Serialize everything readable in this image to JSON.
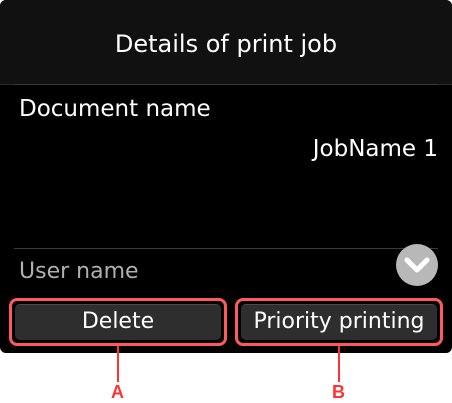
{
  "screen": {
    "title": "Details of print job",
    "document_label": "Document name",
    "document_value": "JobName 1",
    "user_label": "User name",
    "scroll_icon": "chevron-down-icon"
  },
  "buttons": {
    "delete_label": "Delete",
    "priority_label": "Priority printing"
  },
  "callouts": {
    "a": "A",
    "b": "B"
  },
  "colors": {
    "screen_bg": "#000000",
    "highlight": "#ff5a5a",
    "callout": "#ff3333"
  }
}
